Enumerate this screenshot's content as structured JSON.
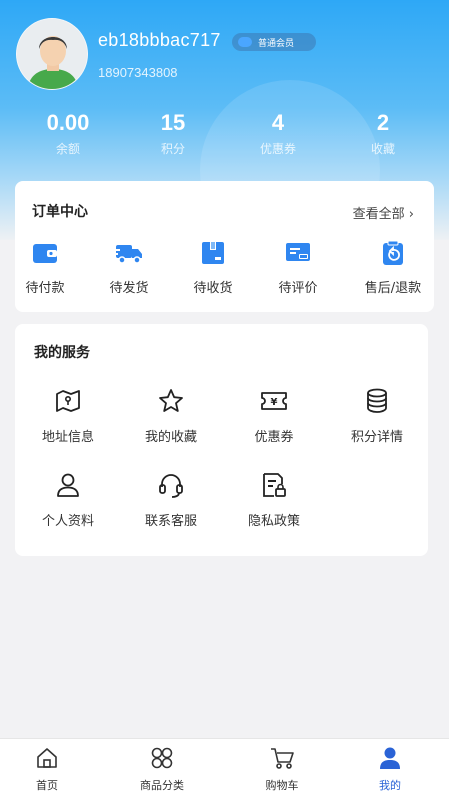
{
  "profile": {
    "username": "eb18bbbac717",
    "member_badge": "普通会员",
    "phone": "18907343808"
  },
  "stats": [
    {
      "value": "0.00",
      "label": "余额"
    },
    {
      "value": "15",
      "label": "积分"
    },
    {
      "value": "4",
      "label": "优惠券"
    },
    {
      "value": "2",
      "label": "收藏"
    }
  ],
  "orders": {
    "title": "订单中心",
    "view_all": "查看全部 ›",
    "items": [
      {
        "label": "待付款",
        "icon": "wallet-icon"
      },
      {
        "label": "待发货",
        "icon": "truck-icon"
      },
      {
        "label": "待收货",
        "icon": "box-icon"
      },
      {
        "label": "待评价",
        "icon": "comment-icon"
      },
      {
        "label": "售后/退款",
        "icon": "refund-icon"
      }
    ]
  },
  "services": {
    "title": "我的服务",
    "items": [
      {
        "label": "地址信息",
        "icon": "map-icon"
      },
      {
        "label": "我的收藏",
        "icon": "star-icon"
      },
      {
        "label": "优惠券",
        "icon": "coupon-icon"
      },
      {
        "label": "积分详情",
        "icon": "coins-icon"
      },
      {
        "label": "个人资料",
        "icon": "user-icon"
      },
      {
        "label": "联系客服",
        "icon": "headset-icon"
      },
      {
        "label": "隐私政策",
        "icon": "privacy-document-icon"
      }
    ]
  },
  "tabbar": {
    "items": [
      {
        "label": "首页",
        "icon": "home-icon"
      },
      {
        "label": "商品分类",
        "icon": "category-icon"
      },
      {
        "label": "购物车",
        "icon": "cart-icon"
      },
      {
        "label": "我的",
        "icon": "profile-icon"
      }
    ],
    "active_color": "#2a63d6"
  },
  "colors": {
    "accent_blue": "#2f86f0",
    "header_top": "#2ea8f6"
  }
}
